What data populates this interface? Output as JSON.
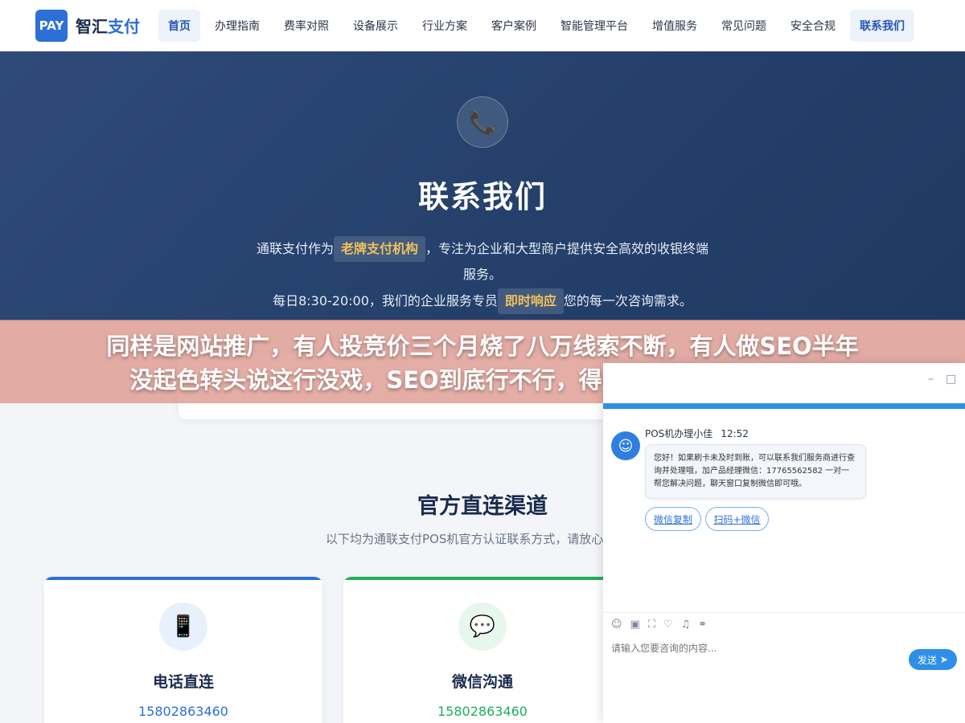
{
  "nav": {
    "logo_badge": "PAY",
    "logo_main": "智汇",
    "logo_accent": "支付",
    "items": [
      {
        "label": "首页",
        "active": true
      },
      {
        "label": "办理指南"
      },
      {
        "label": "费率对照"
      },
      {
        "label": "设备展示"
      },
      {
        "label": "行业方案"
      },
      {
        "label": "客户案例"
      },
      {
        "label": "智能管理平台"
      },
      {
        "label": "增值服务"
      },
      {
        "label": "常见问题"
      },
      {
        "label": "安全合规"
      },
      {
        "label": "联系我们"
      }
    ]
  },
  "hero": {
    "icon": "phone-icon",
    "title": "联系我们",
    "line1_pre": "通联支付作为",
    "line1_hl": "老牌支付机构",
    "line1_post": "，专注为企业和大型商户提供安全高效的收银终端",
    "line2": "服务。",
    "line3_pre": "每日8:30-20:00，我们的企业服务专员",
    "line3_hl": "即时响应",
    "line3_post": "您的每一次咨询需求。"
  },
  "banner": {
    "line1": "同样是网站推广，有人投竞价三个月烧了八万线索不断，有人做SEO半年",
    "line2": "没起色转头说这行没戏，SEO到底行不行，得先看你符不符合这三条"
  },
  "section": {
    "title": "官方直连渠道",
    "subtitle": "以下均为通联支付POS机官方认证联系方式，请放心"
  },
  "cards": [
    {
      "title": "电话直连",
      "phone": "15802863460",
      "icon": "mobile-phone-icon",
      "color": "#2c6fd6"
    },
    {
      "title": "微信沟通",
      "phone": "15802863460",
      "icon": "chat-bubble-icon",
      "color": "#1fae5a"
    }
  ],
  "chat": {
    "agent_name": "POS机办理小佳",
    "time": "12:52",
    "message": "您好！如果刷卡未及时到账，可以联系我们服务商进行查询并处理哦，加产品经理微信：17765562582 一对一帮您解决问题，聊天窗口复制微信即可哦。",
    "quick_btn1": "微信复制",
    "quick_btn2": "扫码+微信",
    "input_placeholder": "请输入您要咨询的内容...",
    "send_label": "发送"
  }
}
